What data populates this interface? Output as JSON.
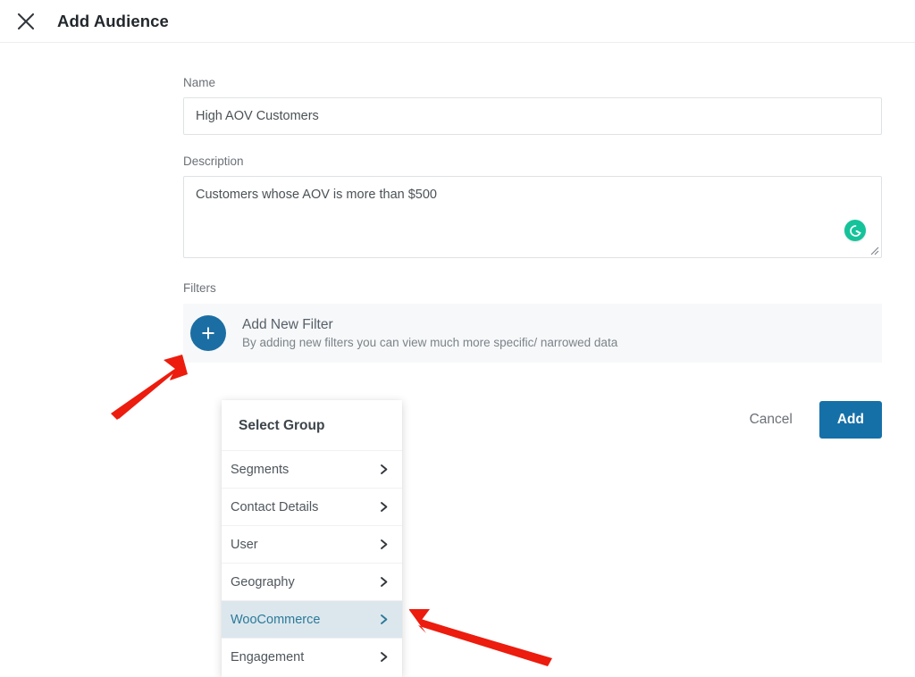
{
  "header": {
    "title": "Add Audience",
    "close_icon": "close-x-icon"
  },
  "form": {
    "name": {
      "label": "Name",
      "value": "High AOV Customers",
      "placeholder": "Name"
    },
    "description": {
      "label": "Description",
      "value": "Customers whose AOV is more than $500",
      "placeholder": "Description",
      "grammarly_icon": "grammarly-icon",
      "resize_handle_icon": "resize-handle-icon"
    },
    "filters": {
      "label": "Filters",
      "add_filter": {
        "icon": "plus-icon",
        "title": "Add New Filter",
        "subtitle": "By adding new filters you can view much more specific/ narrowed data"
      }
    }
  },
  "footer": {
    "cancel_label": "Cancel",
    "add_label": "Add"
  },
  "select_group": {
    "heading": "Select Group",
    "items": [
      {
        "label": "Segments",
        "chevron_icon": "chevron-right-icon",
        "active": false
      },
      {
        "label": "Contact Details",
        "chevron_icon": "chevron-right-icon",
        "active": false
      },
      {
        "label": "User",
        "chevron_icon": "chevron-right-icon",
        "active": false
      },
      {
        "label": "Geography",
        "chevron_icon": "chevron-right-icon",
        "active": false
      },
      {
        "label": "WooCommerce",
        "chevron_icon": "chevron-right-icon",
        "active": true
      },
      {
        "label": "Engagement",
        "chevron_icon": "chevron-right-icon",
        "active": false
      }
    ]
  },
  "annotations": [
    {
      "name": "arrow-to-add-filter-button",
      "target": "Add New Filter plus button"
    },
    {
      "name": "arrow-to-woocommerce-item",
      "target": "WooCommerce menu row"
    }
  ],
  "colors": {
    "accent_blue": "#1670a8",
    "plus_blue": "#1b6ea3",
    "grammarly_green": "#15c39a",
    "active_row_bg": "#dce7ed",
    "active_row_text": "#2b7a99",
    "annotation_red": "#ec1c0e",
    "filter_row_bg": "#f7f8f9"
  }
}
